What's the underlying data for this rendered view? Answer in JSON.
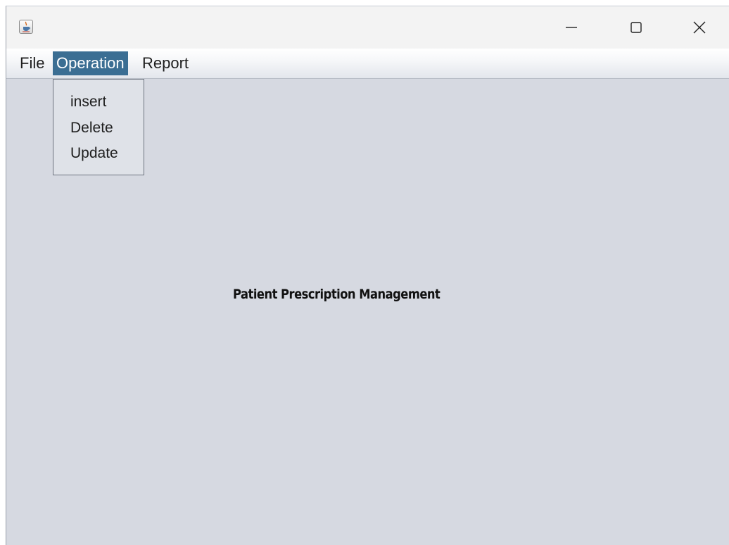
{
  "window": {
    "icon": "java-cup-icon",
    "controls": {
      "minimize_icon": "minimize-icon",
      "maximize_icon": "maximize-icon",
      "close_icon": "close-icon"
    }
  },
  "menubar": {
    "items": [
      {
        "label": "File"
      },
      {
        "label": "Operation",
        "active": true
      },
      {
        "label": "Report"
      }
    ]
  },
  "dropdown": {
    "parent": "Operation",
    "items": [
      {
        "label": "insert"
      },
      {
        "label": "Delete"
      },
      {
        "label": "Update"
      }
    ]
  },
  "main": {
    "title": "Patient Prescription Management"
  },
  "colors": {
    "content_bg": "#d6d9e1",
    "menu_highlight": "#3b6e93",
    "titlebar_bg": "#f3f3f3"
  }
}
